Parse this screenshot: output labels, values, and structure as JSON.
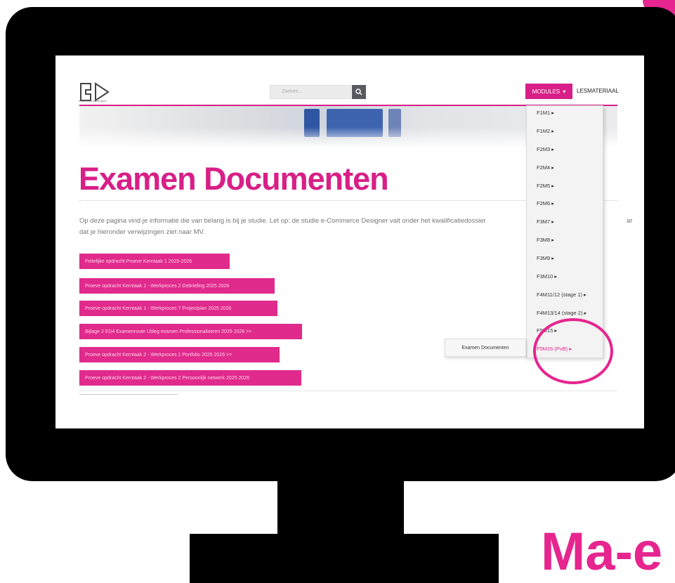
{
  "colors": {
    "accent": "#d81f87",
    "brand": "#e6258f",
    "bezel": "#000000"
  },
  "site": {
    "logo_subtext": "E-commerce Designer",
    "search_placeholder": "Zoeken...",
    "modules_label": "MODULES",
    "lesmateriaal_label": "LESMATERIAAL"
  },
  "page": {
    "title": "Examen Documenten",
    "intro_line1": "Op deze pagina vind je informatie die van belang is bij je studie. Let op: de studie e-Commerce Designer valt onder het kwalificatiedossier",
    "intro_tail": "ar",
    "intro_line2": "dat je hieronder verwijzingen ziet naar MV."
  },
  "documents": [
    "Feitelijke opdracht Proeve Kerntaak 1 2025-2026",
    "Proeve opdracht Kerntaak 1 - Werkproces 2 Debriefing 2025 2026",
    "Proeve opdracht Kerntaak 1 - Werkproces 7 Projectplan 2025 2026",
    "Bijlage 2 ED4 Examenroute Uitleg examen Professionaliseren 2025 2026 >>",
    "Proeve opdracht Kerntaak 2 - Werkproces 1 Portfolio 2025 2026 >>",
    "Proeve opdracht Kerntaak 2 - Werkproces 2 Persoonlijk netwerk 2025 2026"
  ],
  "modules_menu": [
    "F1M1 ▸",
    "F1M2 ▸",
    "F2M3 ▸",
    "F2M4 ▸",
    "F2M5 ▸",
    "F2M6 ▸",
    "F3M7 ▸",
    "F3M8 ▸",
    "F3M9 ▸",
    "F3M10 ▸",
    "F4M11/12 (stage 1) ▸",
    "F4M13/14 (stage 2) ▸",
    "F5M15 ▸",
    "F5M16 (PvB) ▸"
  ],
  "submenu": {
    "item": "Examen Documenten"
  },
  "overlay": {
    "brand_text": "Ma-e"
  }
}
